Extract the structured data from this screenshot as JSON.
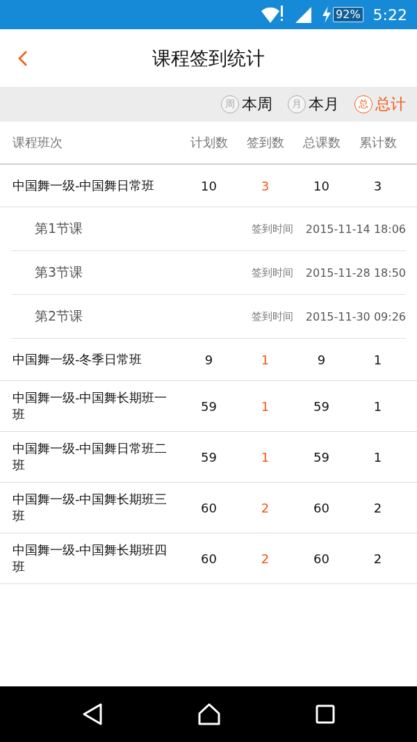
{
  "status_bar": {
    "battery": "92%",
    "time": "5:22"
  },
  "header": {
    "title": "课程签到统计"
  },
  "filters": [
    {
      "icon_char": "周",
      "label": "本周",
      "selected": false
    },
    {
      "icon_char": "月",
      "label": "本月",
      "selected": false
    },
    {
      "icon_char": "总",
      "label": "总计",
      "selected": true
    }
  ],
  "table": {
    "columns": [
      "课程班次",
      "计划数",
      "签到数",
      "总课数",
      "累计数"
    ],
    "rows": [
      {
        "name": "中国舞一级-中国舞日常班",
        "planned": "10",
        "signed": "3",
        "total": "10",
        "cumulative": "3",
        "children": [
          {
            "name": "第1节课",
            "time_label": "签到时间",
            "time": "2015-11-14 18:06"
          },
          {
            "name": "第3节课",
            "time_label": "签到时间",
            "time": "2015-11-28 18:50"
          },
          {
            "name": "第2节课",
            "time_label": "签到时间",
            "time": "2015-11-30 09:26"
          }
        ]
      },
      {
        "name": "中国舞一级-冬季日常班",
        "planned": "9",
        "signed": "1",
        "total": "9",
        "cumulative": "1"
      },
      {
        "name": "中国舞一级-中国舞长期班一班",
        "planned": "59",
        "signed": "1",
        "total": "59",
        "cumulative": "1"
      },
      {
        "name": "中国舞一级-中国舞日常班二班",
        "planned": "59",
        "signed": "1",
        "total": "59",
        "cumulative": "1"
      },
      {
        "name": "中国舞一级-中国舞长期班三班",
        "planned": "60",
        "signed": "2",
        "total": "60",
        "cumulative": "2"
      },
      {
        "name": "中国舞一级-中国舞长期班四班",
        "planned": "60",
        "signed": "2",
        "total": "60",
        "cumulative": "2"
      }
    ]
  }
}
